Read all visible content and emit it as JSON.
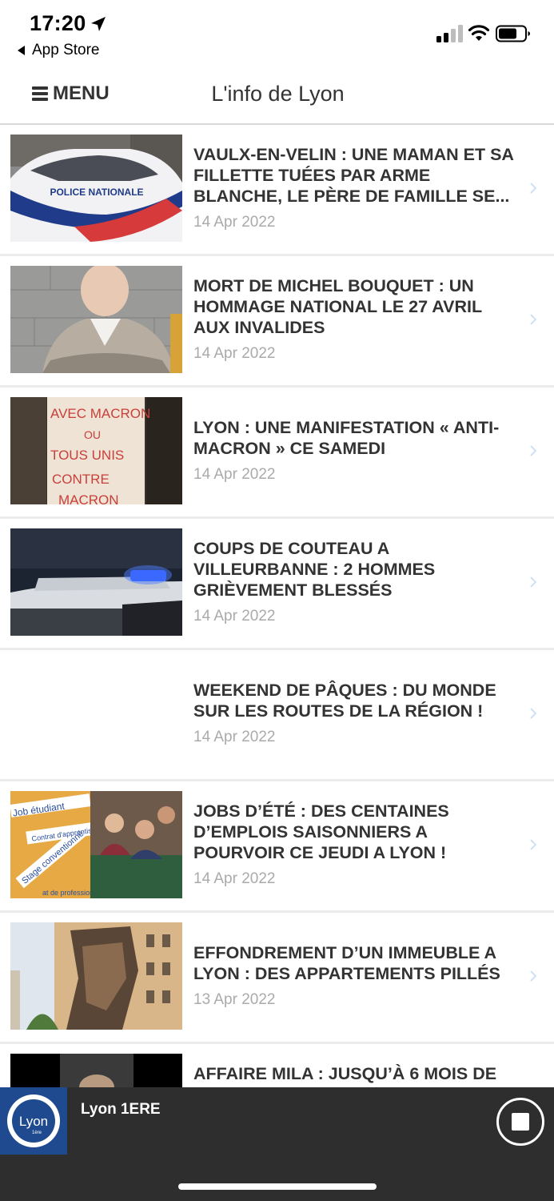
{
  "status_bar": {
    "time": "17:20",
    "back_app": "App Store"
  },
  "header": {
    "menu_label": "MENU",
    "title": "L'info de Lyon"
  },
  "articles": [
    {
      "title": "VAULX-EN-VELIN : UNE MAMAN ET SA FILLETTE TUÉES PAR ARME BLANCHE, LE PÈRE DE FAMILLE SE...",
      "date": "14 Apr 2022",
      "thumb_text": "POLICE NATIONALE"
    },
    {
      "title": "MORT DE MICHEL BOUQUET : UN HOMMAGE NATIONAL LE 27 AVRIL AUX INVALIDES",
      "date": "14 Apr 2022"
    },
    {
      "title": "LYON : UNE MANIFESTATION « ANTI-MACRON » CE SAMEDI",
      "date": "14 Apr 2022",
      "thumb_text": [
        "AVEC MACRON",
        "OU",
        "TOUS UNIS",
        "CONTRE",
        "MACRON"
      ]
    },
    {
      "title": "COUPS DE COUTEAU A VILLEURBANNE : 2 HOMMES GRIÈVEMENT BLESSÉS",
      "date": "14 Apr 2022"
    },
    {
      "title": "WEEKEND DE PÂQUES : DU MONDE SUR LES ROUTES DE LA RÉGION !",
      "date": "14 Apr 2022"
    },
    {
      "title": "JOBS D’ÉTÉ : DES CENTAINES D’EMPLOIS SAISONNIERS A POURVOIR CE JEUDI A LYON !",
      "date": "14 Apr 2022",
      "thumb_text": [
        "Job étudiant",
        "Contrat d'apprentissage",
        "Stage conventionné",
        "at de professionnalisation"
      ]
    },
    {
      "title": "EFFONDREMENT D’UN IMMEUBLE A LYON : DES APPARTEMENTS PILLÉS",
      "date": "13 Apr 2022"
    },
    {
      "title": "AFFAIRE MILA : JUSQU’À 6 MOIS DE",
      "date": ""
    }
  ],
  "player": {
    "station": "Lyon 1ERE",
    "logo_text": "Lyon",
    "logo_subtext": "1ère"
  },
  "colors": {
    "player_bg": "#2e2e2e",
    "logo_bg": "#1f4a8f",
    "chevron": "#cfe0f5",
    "date": "#aaaaaa",
    "title": "#333333"
  }
}
